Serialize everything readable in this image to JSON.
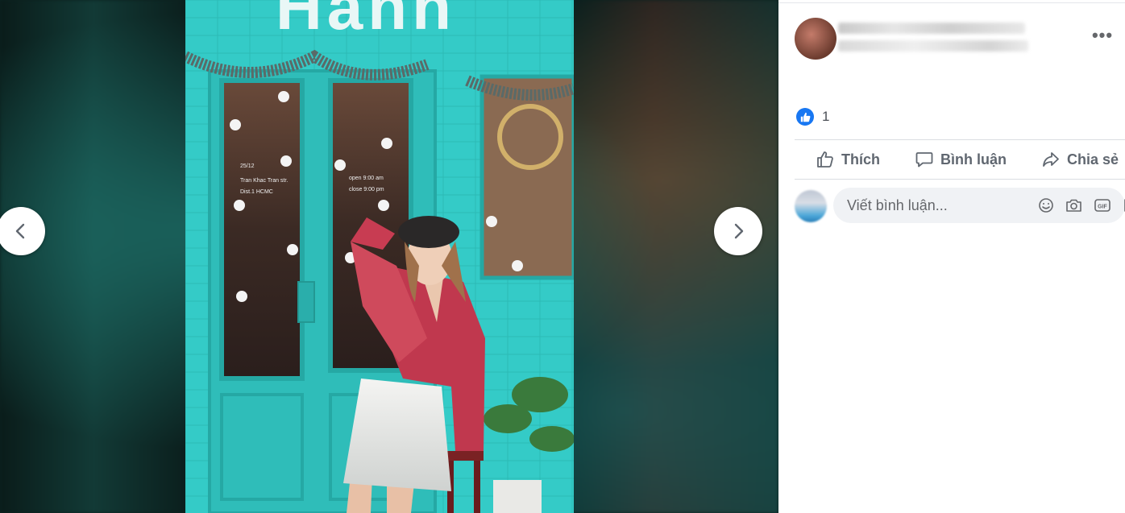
{
  "photo_viewer": {
    "prev_icon": "chevron-left-icon",
    "next_icon": "chevron-right-icon",
    "photo": {
      "shop_sign_partial": "Hanh",
      "window_sign": [
        "25/12",
        "Tran Khac Tran str.",
        "Dist.1 HCMC"
      ],
      "hours_sign": [
        "open 9:00 am",
        "close 9:00 pm"
      ]
    }
  },
  "post": {
    "more_icon": "more-horizontal-icon",
    "more_label": "•••",
    "reactions": {
      "icon": "like-reaction-icon",
      "count": "1"
    },
    "actions": [
      {
        "label": "Thích",
        "icon": "thumbs-up-icon"
      },
      {
        "label": "Bình luận",
        "icon": "comment-bubble-icon"
      },
      {
        "label": "Chia sẻ",
        "icon": "share-arrow-icon"
      }
    ],
    "comment": {
      "placeholder": "Viết bình luận...",
      "tools": [
        "emoji-icon",
        "camera-icon",
        "gif-icon",
        "sticker-icon"
      ]
    }
  },
  "colors": {
    "accent": "#1877f2",
    "wall_teal": "#32c7c4",
    "muted_text": "#606770"
  }
}
